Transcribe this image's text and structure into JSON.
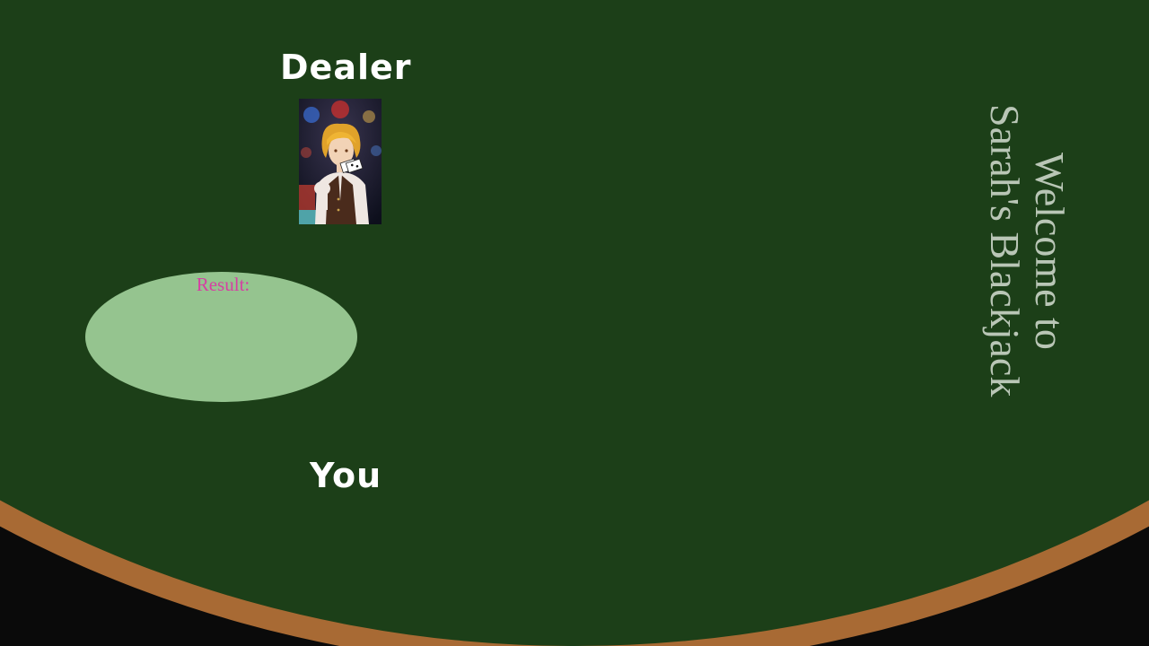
{
  "table": {
    "felt_color": "#1c3f18",
    "rail_color": "#a86a34",
    "background_color": "#0a0a0a"
  },
  "dealer": {
    "label": "Dealer",
    "avatar_icon": "dealer-portrait"
  },
  "player": {
    "label": "You"
  },
  "result": {
    "label": "Result:",
    "oval_color": "#95c48f",
    "label_color": "#d63fa3"
  },
  "welcome": {
    "line1": "Welcome to",
    "line2": "Sarah's Blackjack"
  }
}
